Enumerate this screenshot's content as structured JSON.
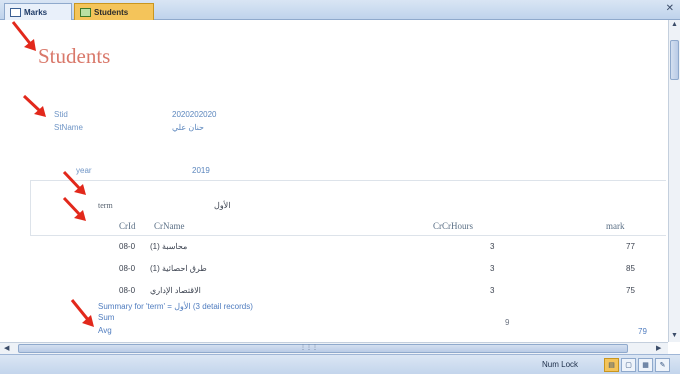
{
  "tabs": [
    {
      "label": "Marks"
    },
    {
      "label": "Students"
    }
  ],
  "report": {
    "title": "Students",
    "fields": {
      "stid_label": "Stid",
      "stid_value": "2020202020",
      "stname_label": "StName",
      "stname_value": "حنان علي",
      "year_label": "year",
      "year_value": "2019"
    },
    "group": {
      "term_label": "term",
      "term_value": "الأول"
    },
    "columns": [
      "CrId",
      "CrName",
      "CrCrHours",
      "mark"
    ],
    "rows": [
      {
        "crid": "08-0",
        "crname": "(1) محاسبة",
        "hours": "3",
        "mark": "77"
      },
      {
        "crid": "08-0",
        "crname": "طرق احصائية (1)",
        "hours": "3",
        "mark": "85"
      },
      {
        "crid": "08-0",
        "crname": "الاقتصاد الإداري",
        "hours": "3",
        "mark": "75"
      }
    ],
    "summary": {
      "text": "Summary for 'term' = ",
      "text_tail": "الأول (3 detail records)",
      "sum_label": "Sum",
      "sum_value": "9",
      "avg_label": "Avg",
      "avg_value": "79"
    }
  },
  "statusbar": {
    "numlock": "Num Lock"
  },
  "colors": {
    "title": "#d9786a",
    "arrow": "#e2281b",
    "active_tab": "#f4c45a"
  }
}
